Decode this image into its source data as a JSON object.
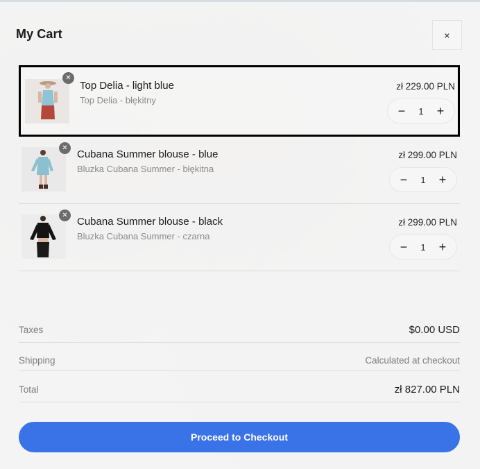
{
  "cart": {
    "title": "My Cart",
    "close_label": "×"
  },
  "items": [
    {
      "name": "Top Delia - light blue",
      "subname": "Top Delia - błękitny",
      "price": "zł 229.00 PLN",
      "quantity": "1",
      "remove_label": "✕",
      "decrement_label": "−",
      "increment_label": "+",
      "selected": true
    },
    {
      "name": "Cubana Summer blouse - blue",
      "subname": "Bluzka Cubana Summer - błękitna",
      "price": "zł 299.00 PLN",
      "quantity": "1",
      "remove_label": "✕",
      "decrement_label": "−",
      "increment_label": "+",
      "selected": false
    },
    {
      "name": "Cubana Summer blouse - black",
      "subname": "Bluzka Cubana Summer - czarna",
      "price": "zł 299.00 PLN",
      "quantity": "1",
      "remove_label": "✕",
      "decrement_label": "−",
      "increment_label": "+",
      "selected": false
    }
  ],
  "summary": {
    "taxes_label": "Taxes",
    "taxes_value": "$0.00 USD",
    "shipping_label": "Shipping",
    "shipping_value": "Calculated at checkout",
    "total_label": "Total",
    "total_value": "zł 827.00 PLN"
  },
  "checkout_label": "Proceed to Checkout",
  "colors": {
    "accent": "#3a72e8",
    "selection_border": "#000000",
    "remove_badge": "#6b6b6b"
  }
}
